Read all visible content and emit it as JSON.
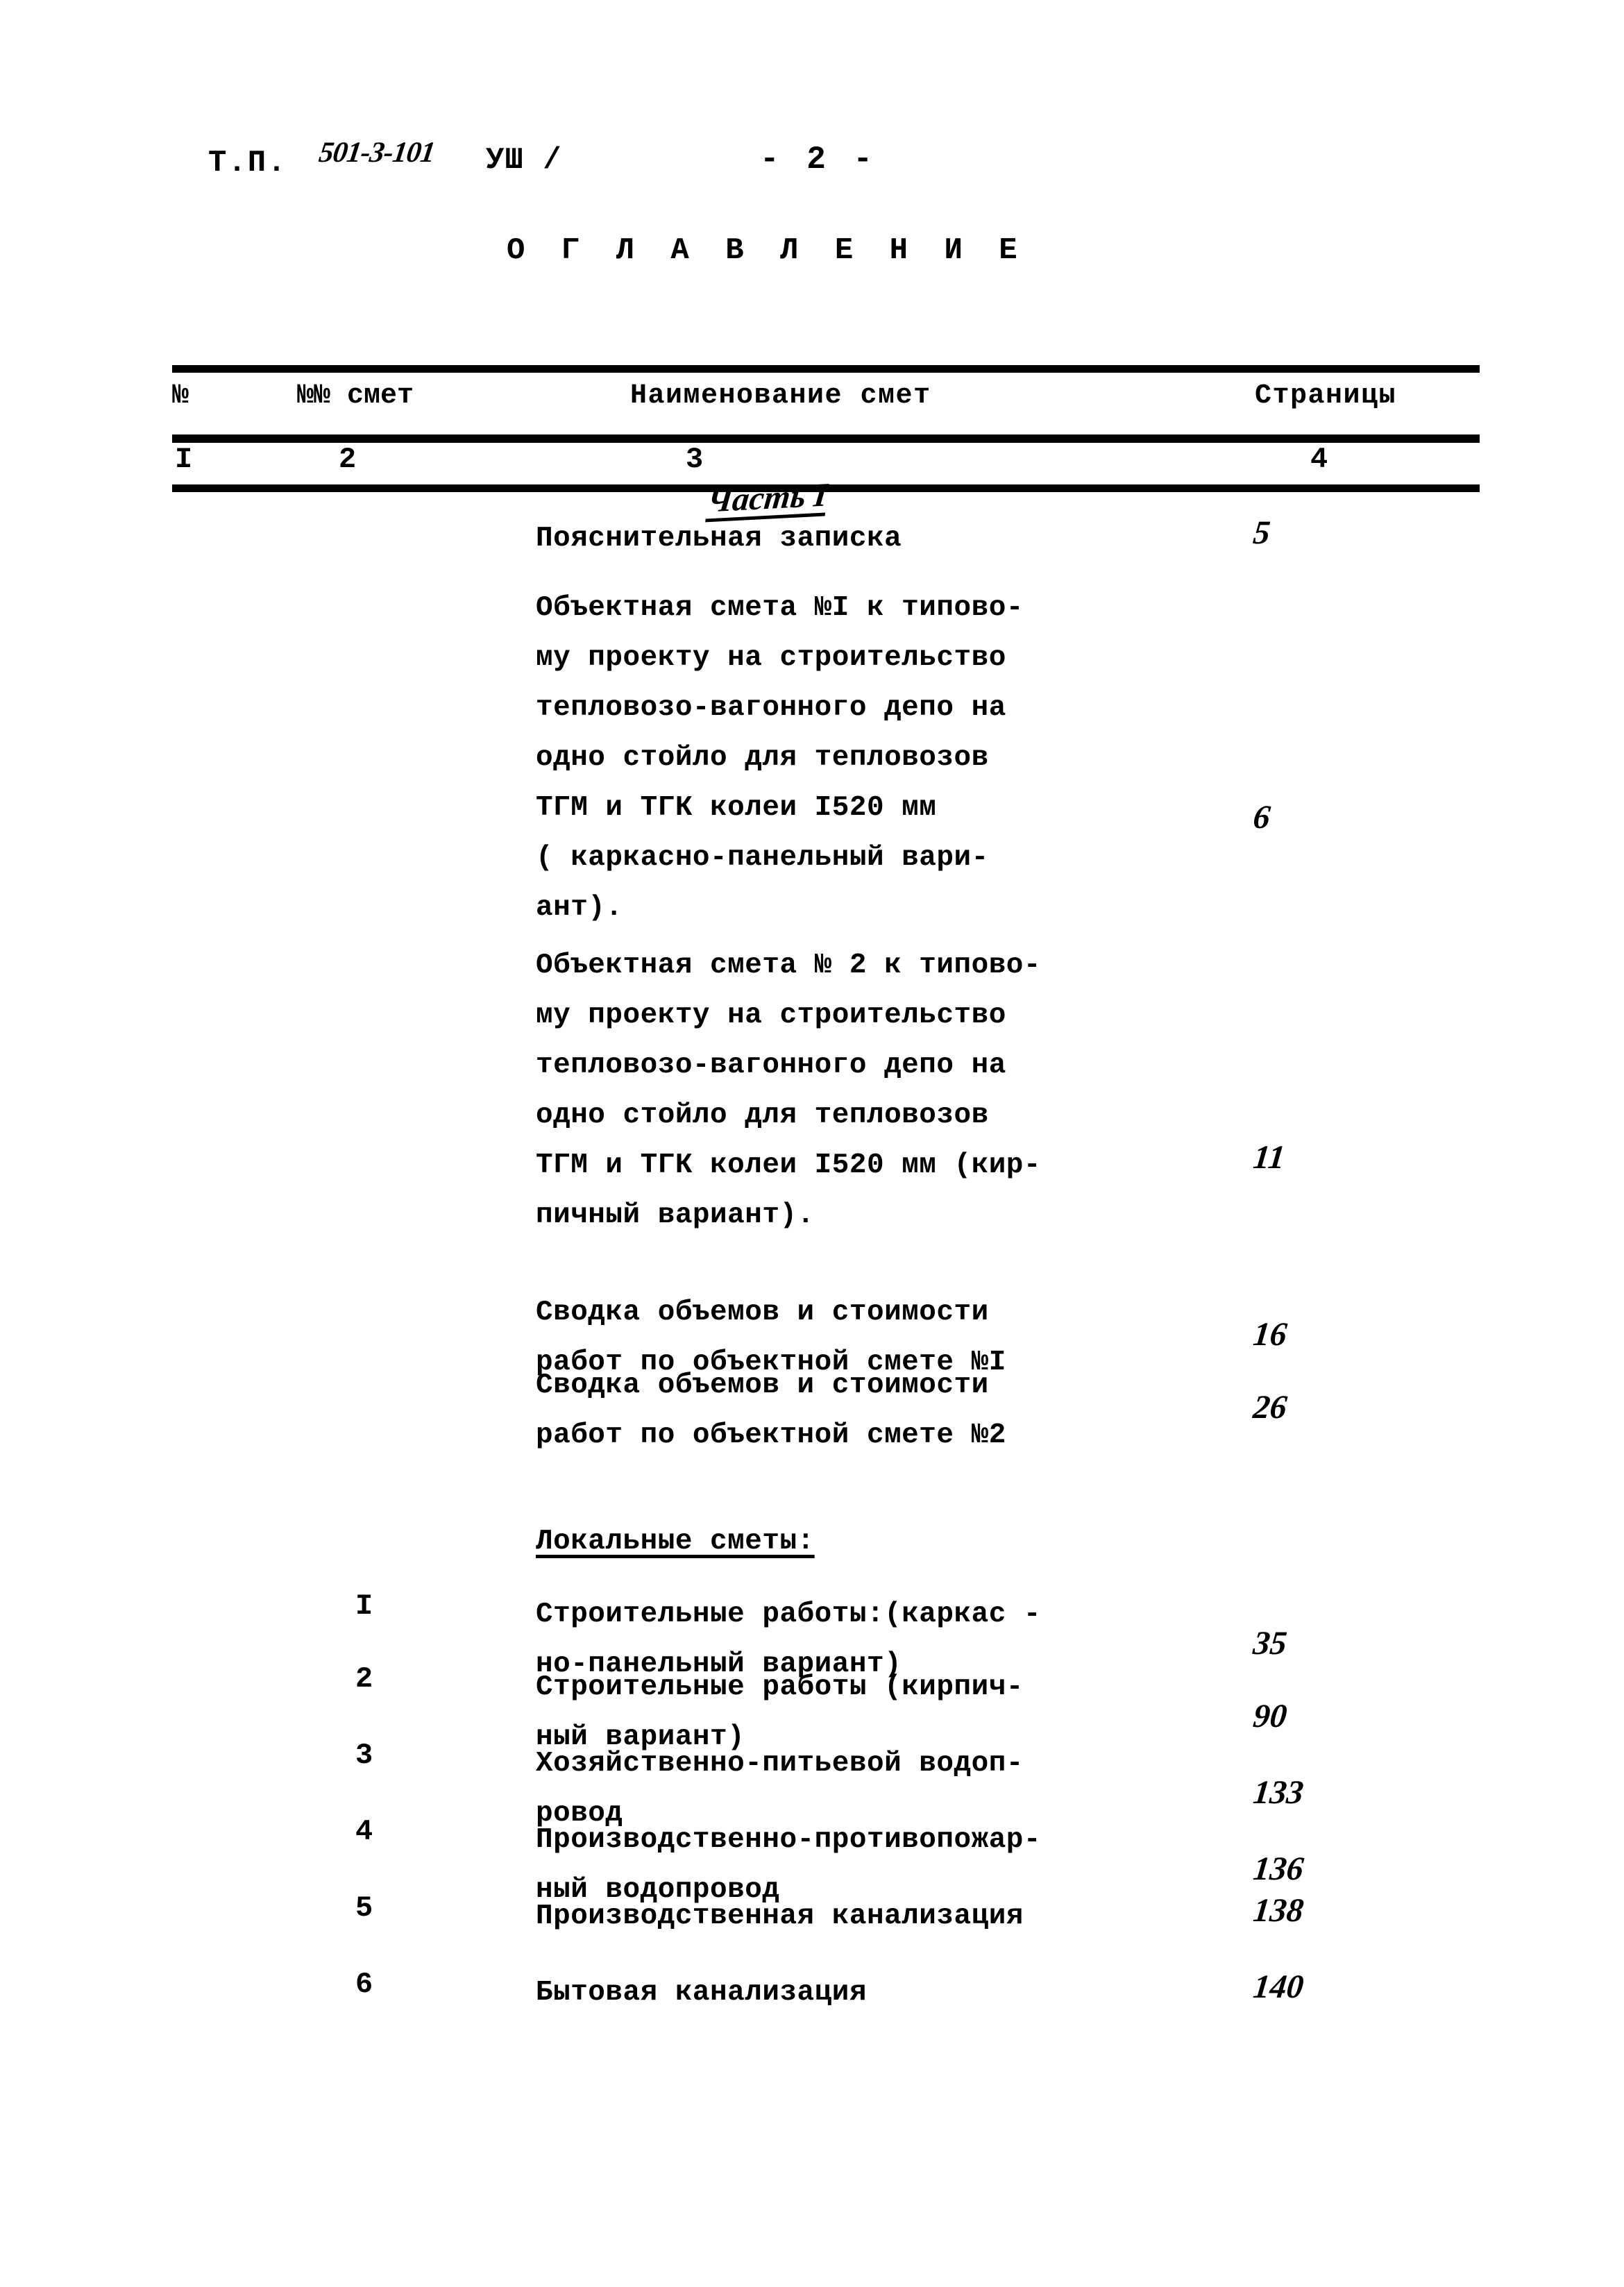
{
  "header": {
    "tp_label": "Т.П.",
    "tp_code": "501-3-101",
    "tp_part": "УШ /",
    "page_marker": "- 2 -"
  },
  "section_title": "О Г Л А В Л Е Н И Е",
  "table": {
    "headers": {
      "col_a": "№",
      "col_b": "№№ смет",
      "col_c": "Наименование смет",
      "col_d": "Страницы"
    },
    "column_numbers": {
      "col_a": "I",
      "col_b": "2",
      "col_c": "3",
      "col_d": "4"
    },
    "rows": [
      {
        "num": "",
        "text": "Пояснительная записка",
        "page": "5"
      },
      {
        "num": "",
        "text": "Объектная смета №I к типово-\nму проекту на строительство\nтепловозо-вагонного депо на\nодно стойло для тепловозов\nТГМ и ТГК колеи I520 мм\n ( каркасно-панельный вари-\nант).",
        "page": "6"
      },
      {
        "num": "",
        "text": "Объектная смета № 2 к типово-\nму проекту на строительство\nтепловозо-вагонного депо на\nодно стойло для тепловозов\nТГМ и ТГК колеи I520 мм (кир-\nпичный вариант).",
        "page": "11"
      },
      {
        "num": "",
        "text": "Сводка объемов и стоимости\nработ по объектной смете №I",
        "page": "16"
      },
      {
        "num": "",
        "text": "Сводка объемов и стоимости\nработ по объектной смете №2",
        "page": "26"
      },
      {
        "num": "",
        "text": "Локальные сметы:",
        "page": "",
        "underline": true
      },
      {
        "num": "I",
        "text": "Строительные работы:(каркас -\nно-панельный вариант)",
        "page": "35"
      },
      {
        "num": "2",
        "text": "Строительные работы (кирпич-\nный вариант)",
        "page": "90"
      },
      {
        "num": "3",
        "text": "Хозяйственно-питьевой водоп-\nровод",
        "page": "133"
      },
      {
        "num": "4",
        "text": "Производственно-противопожар-\nный водопровод",
        "page": "136"
      },
      {
        "num": "5",
        "text": "Производственная канализация",
        "page": "138"
      },
      {
        "num": "6",
        "text": "Бытовая канализация",
        "page": "140"
      }
    ]
  },
  "annotation": {
    "part_note": "Часть I"
  }
}
